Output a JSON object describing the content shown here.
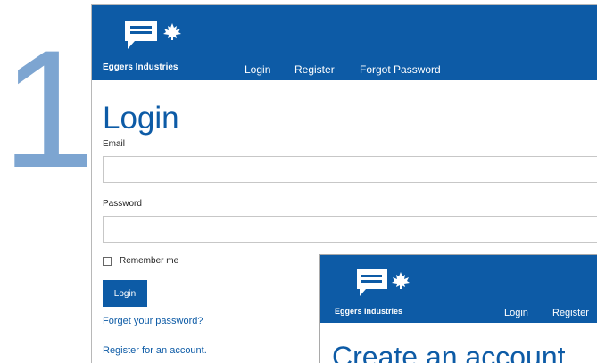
{
  "step": {
    "number": "1"
  },
  "colors": {
    "brand_blue": "#0d5ba6",
    "step_number": "#7da5d1"
  },
  "login_window": {
    "brand_name": "Eggers Industries",
    "logo_icons": [
      "speech-bubble-icon",
      "maple-leaf-icon"
    ],
    "nav": {
      "login": "Login",
      "register": "Register",
      "forgot_password": "Forgot Password"
    },
    "title": "Login",
    "email_label": "Email",
    "email_value": "",
    "password_label": "Password",
    "password_value": "",
    "remember_label": "Remember me",
    "remember_checked": false,
    "login_button": "Login",
    "forget_link": "Forget your password?",
    "register_link": "Register for an account."
  },
  "register_window": {
    "brand_name": "Eggers Industries",
    "nav": {
      "login": "Login",
      "register": "Register"
    },
    "title": "Create an account"
  }
}
